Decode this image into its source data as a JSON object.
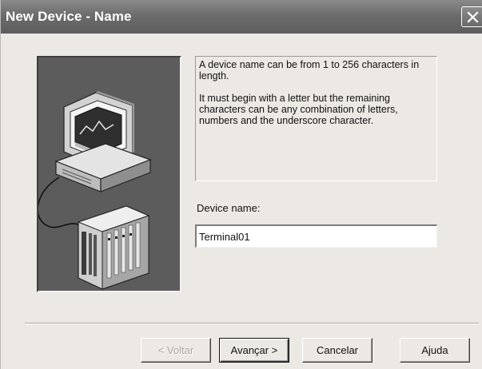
{
  "window": {
    "title": "New Device - Name"
  },
  "info": {
    "paragraph1": "A device name can be from 1 to 256 characters in length.",
    "paragraph2": "It must begin with a letter but the remaining characters can be any combination of letters, numbers and the underscore character."
  },
  "device_name": {
    "label": "Device name:",
    "value": "Terminal01"
  },
  "buttons": {
    "back": "< Voltar",
    "next": "Avançar >",
    "cancel": "Cancelar",
    "help": "Ajuda"
  },
  "icons": {
    "illustration": "computer-with-plc-device",
    "close": "close-icon"
  }
}
